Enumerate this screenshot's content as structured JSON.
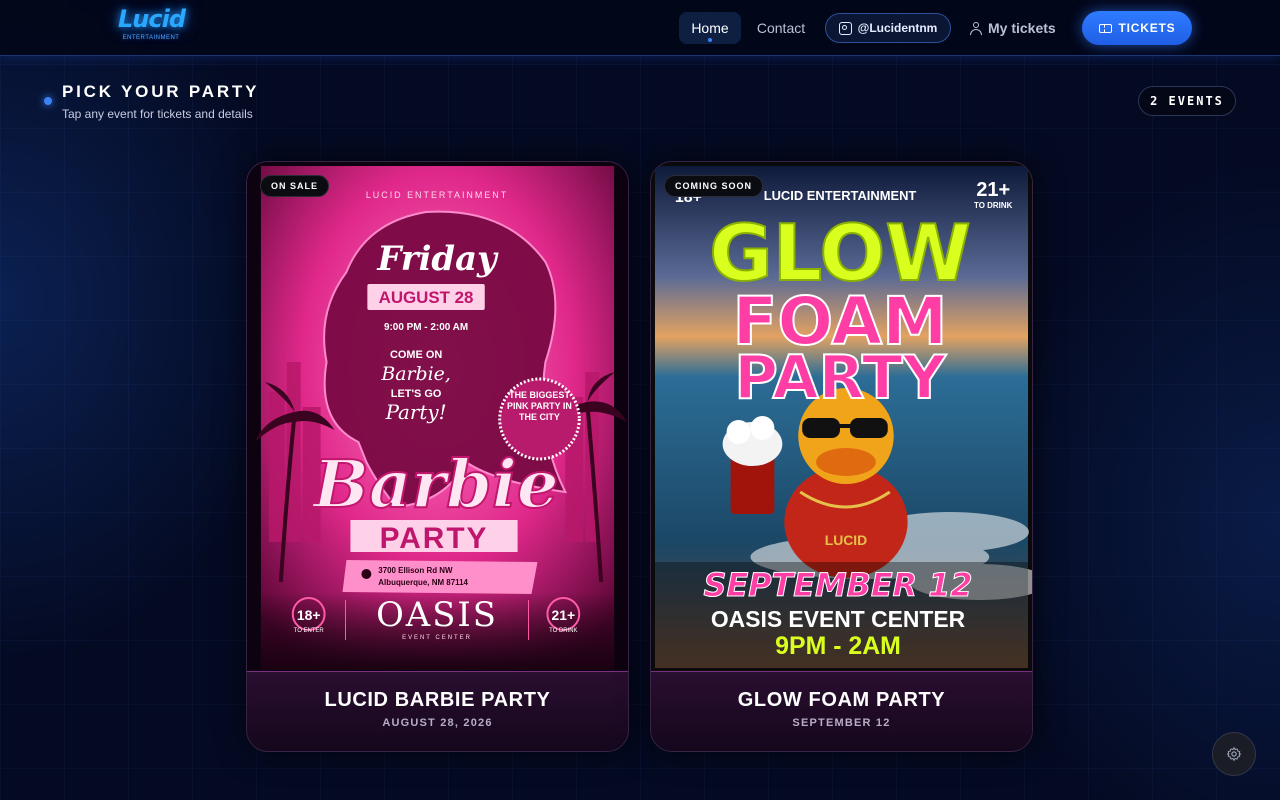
{
  "header": {
    "logo_text": "Lucid",
    "logo_subtext": "ENTERTAINMENT",
    "nav": [
      {
        "label": "Home",
        "active": true
      },
      {
        "label": "Contact",
        "active": false
      }
    ],
    "instagram_label": "@Lucidentnm",
    "my_tickets_label": "My tickets",
    "tickets_button_label": "TICKETS"
  },
  "section": {
    "title": "PICK YOUR PARTY",
    "subtitle": "Tap any event for tickets and details",
    "events_count_label": "2 EVENTS"
  },
  "events": [
    {
      "status": "ON SALE",
      "title": "LUCID BARBIE PARTY",
      "date": "AUGUST 28, 2026",
      "poster": {
        "brand": "LUCID ENTERTAINMENT",
        "day": "Friday",
        "date": "AUGUST 28",
        "time": "9:00 PM - 2:00 AM",
        "tagline1": "COME ON",
        "tagline2": "Barbie,",
        "tagline3": "LET'S GO",
        "tagline4": "Party!",
        "seal": "THE BIGGEST PINK PARTY IN THE CITY",
        "headline": "Barbie",
        "subheadline": "PARTY",
        "address1": "3700 Ellison Rd NW",
        "address2": "Albuquerque, NM 87114",
        "age_enter": "18+",
        "age_enter_label": "TO ENTER",
        "venue": "OASIS",
        "venue_sub": "EVENT CENTER",
        "age_drink": "21+",
        "age_drink_label": "TO DRINK"
      }
    },
    {
      "status": "COMING SOON",
      "title": "GLOW FOAM PARTY",
      "date": "SEPTEMBER 12",
      "poster": {
        "brand": "LUCID ENTERTAINMENT",
        "age_left": "18+",
        "age_right": "21+",
        "age_right_label": "TO DRINK",
        "line1": "GLOW",
        "line2": "FOAM",
        "line3": "PARTY",
        "shirt": "LUCID",
        "date": "SEPTEMBER 12",
        "venue": "OASIS EVENT CENTER",
        "time": "9PM - 2AM"
      }
    }
  ],
  "colors": {
    "accent": "#2f7bff",
    "background": "#040a22",
    "pink": "#ff3ea5",
    "neon_yellow": "#d8ff1e"
  },
  "icons": {
    "instagram": "instagram-icon",
    "user": "user-icon",
    "ticket": "ticket-icon",
    "settings": "gear-icon"
  }
}
